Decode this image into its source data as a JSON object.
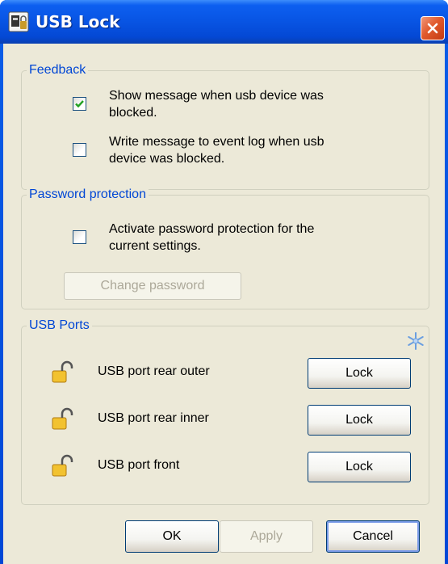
{
  "window": {
    "title": "USB Lock"
  },
  "feedback": {
    "title": "Feedback",
    "options": [
      {
        "line1": "Show message when usb device was",
        "line2": "blocked.",
        "checked": true
      },
      {
        "line1": "Write message to event log when usb",
        "line2": "device was blocked.",
        "checked": false
      }
    ]
  },
  "password": {
    "title": "Password protection",
    "option": {
      "line1": "Activate password protection for the",
      "line2": "current settings.",
      "checked": false
    },
    "change_button": "Change password"
  },
  "usb_ports": {
    "title": "USB Ports",
    "ports": [
      {
        "label": "USB port rear outer",
        "button": "Lock"
      },
      {
        "label": "USB port rear inner",
        "button": "Lock"
      },
      {
        "label": "USB port front",
        "button": "Lock"
      }
    ]
  },
  "buttons": {
    "ok": "OK",
    "apply": "Apply",
    "cancel": "Cancel"
  },
  "colors": {
    "title_bar": "#0854e3",
    "group_title": "#0046d5",
    "dialog_bg": "#ece9d8",
    "close_button": "#e15a2d"
  }
}
